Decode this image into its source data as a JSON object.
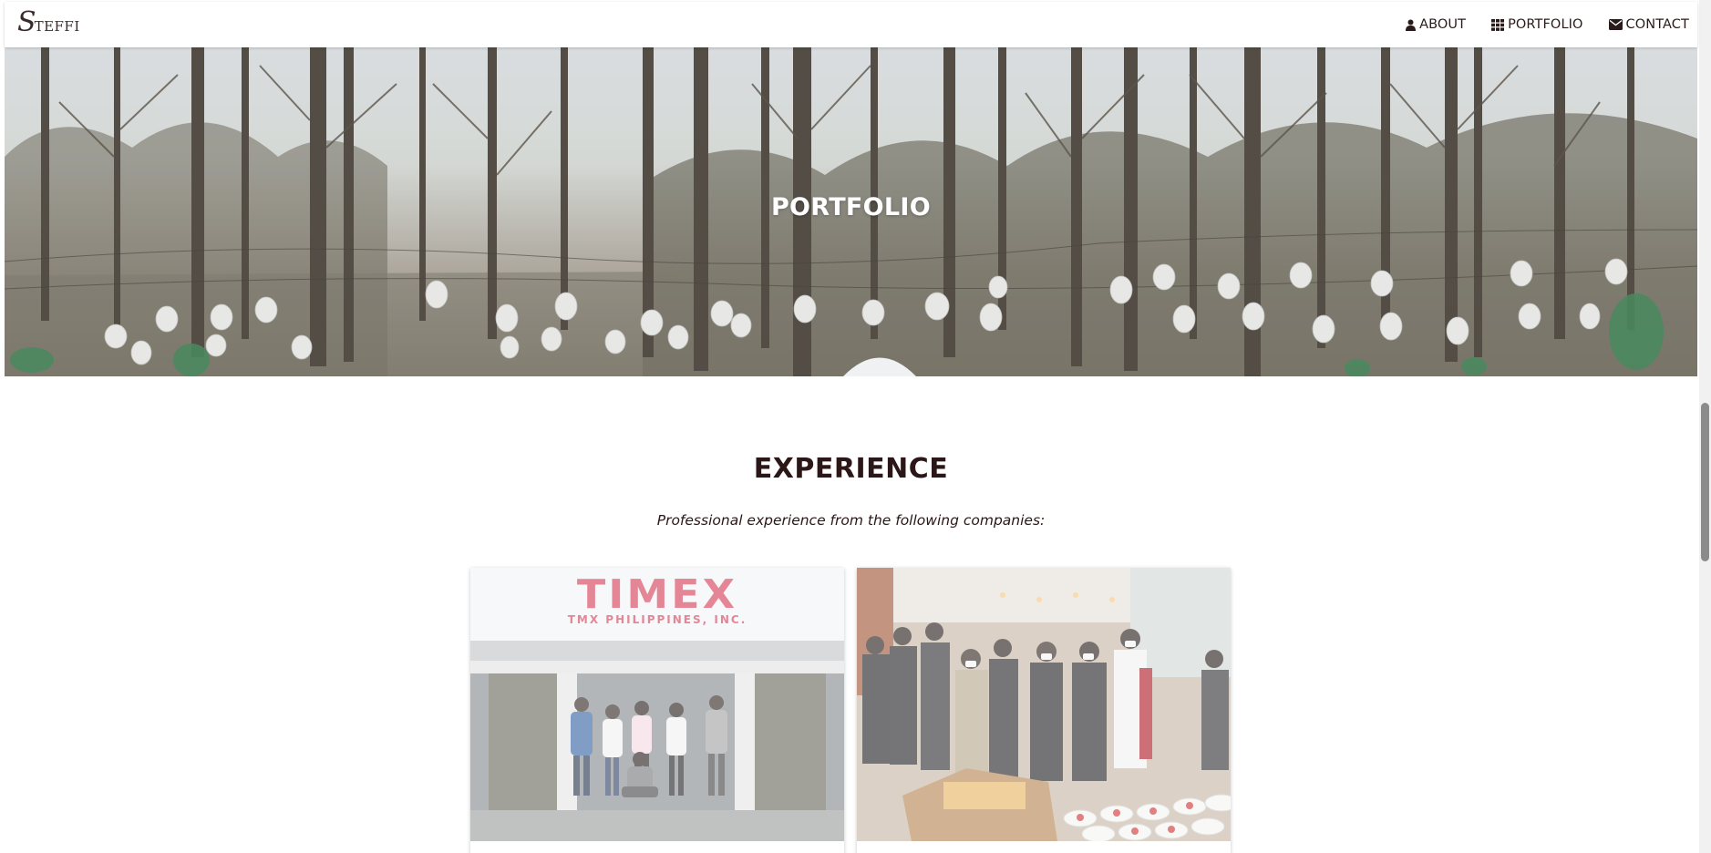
{
  "brand": {
    "initial": "S",
    "rest": "TEFFI"
  },
  "nav": {
    "items": [
      {
        "label": "ABOUT",
        "icon": "user-icon"
      },
      {
        "label": "PORTFOLIO",
        "icon": "grid-icon"
      },
      {
        "label": "CONTACT",
        "icon": "envelope-icon"
      }
    ]
  },
  "hero": {
    "title": "PORTFOLIO"
  },
  "experience": {
    "title": "EXPERIENCE",
    "subtitle": "Professional experience from the following companies:",
    "cards": [
      {
        "logo_text": "TIMEX",
        "logo_tagline": "TMX PHILIPPINES, INC."
      },
      {}
    ]
  },
  "colors": {
    "accent_text": "#2b1717",
    "timex_red": "#d8455f"
  }
}
